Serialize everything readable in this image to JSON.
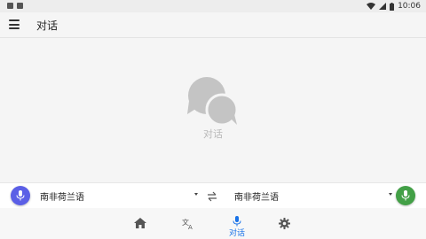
{
  "status_bar": {
    "time": "10:06",
    "icons": [
      "notification-icon",
      "notification-icon",
      "wifi-icon",
      "signal-icon",
      "battery-icon"
    ]
  },
  "app_bar": {
    "title": "对话",
    "menu_icon": "menu-icon"
  },
  "empty_state": {
    "icon": "chat-bubbles-icon",
    "label": "对话"
  },
  "language_bar": {
    "left_language": "南非荷兰语",
    "right_language": "南非荷兰语",
    "swap_icon": "swap-icon",
    "left_mic_color": "#5b5fe6",
    "right_mic_color": "#43a047"
  },
  "bottom_nav": {
    "items": [
      {
        "icon": "home-icon",
        "label": ""
      },
      {
        "icon": "translate-icon",
        "label": ""
      },
      {
        "icon": "mic-icon",
        "label": "对话",
        "active": true
      },
      {
        "icon": "settings-icon",
        "label": ""
      }
    ],
    "active_color": "#1a73e8"
  }
}
